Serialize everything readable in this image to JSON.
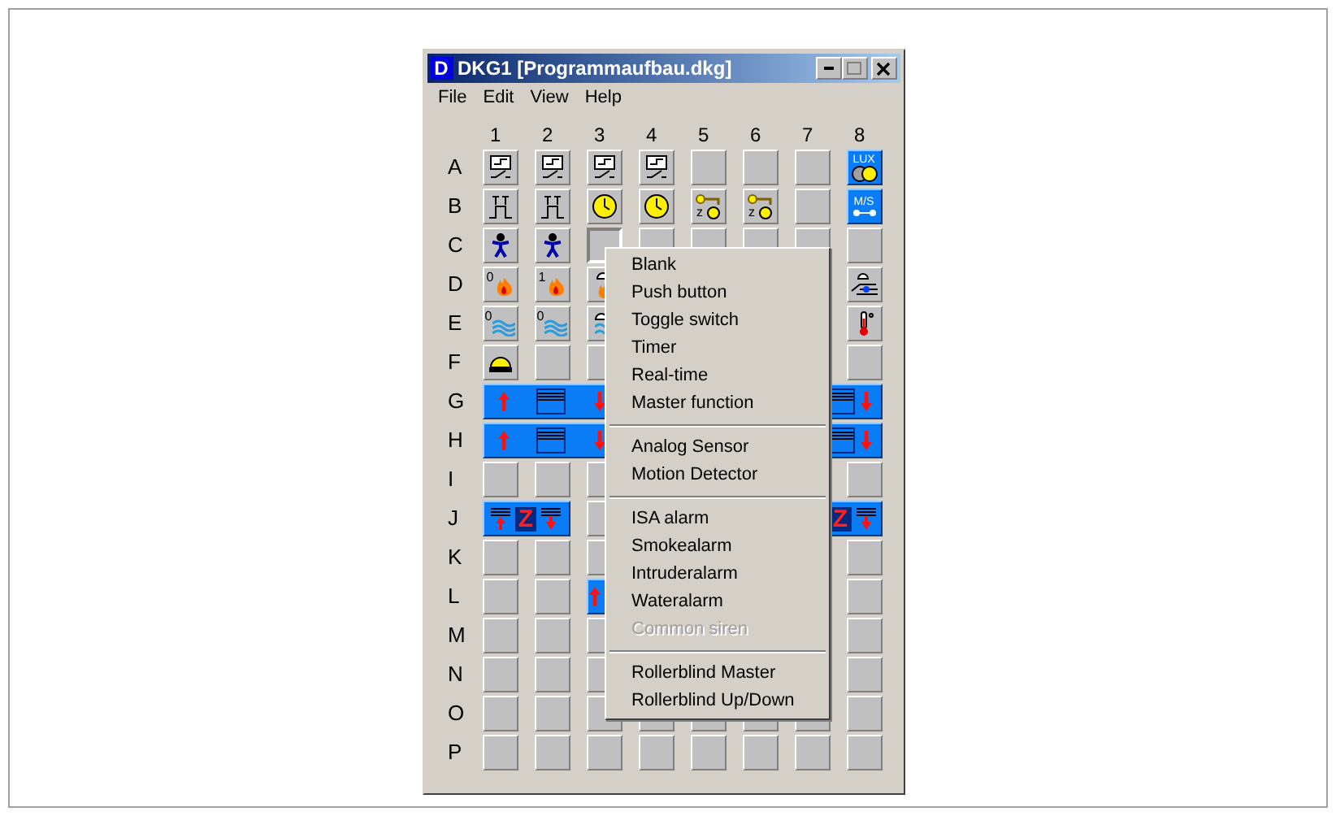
{
  "window": {
    "icon_letter": "D",
    "title": "DKG1 [Programmaufbau.dkg]"
  },
  "menu_bar": [
    {
      "label": "File"
    },
    {
      "label": "Edit"
    },
    {
      "label": "View"
    },
    {
      "label": "Help"
    }
  ],
  "columns": [
    "1",
    "2",
    "3",
    "4",
    "5",
    "6",
    "7",
    "8"
  ],
  "rows": [
    {
      "label": "A",
      "cells": [
        {
          "kind": "switch"
        },
        {
          "kind": "switch"
        },
        {
          "kind": "switch"
        },
        {
          "kind": "switch"
        },
        {
          "kind": "blank"
        },
        {
          "kind": "blank"
        },
        {
          "kind": "blank"
        },
        {
          "kind": "lux",
          "label": "LUX"
        }
      ]
    },
    {
      "label": "B",
      "cells": [
        {
          "kind": "pushbutton"
        },
        {
          "kind": "pushbutton"
        },
        {
          "kind": "clock"
        },
        {
          "kind": "clock"
        },
        {
          "kind": "realtime",
          "label": "z"
        },
        {
          "kind": "realtime",
          "label": "z"
        },
        {
          "kind": "blank"
        },
        {
          "kind": "ms",
          "label": "M/S"
        }
      ]
    },
    {
      "label": "C",
      "cells": [
        {
          "kind": "motion"
        },
        {
          "kind": "motion"
        },
        {
          "kind": "pressed"
        },
        {
          "kind": "blank"
        },
        {
          "kind": "blank"
        },
        {
          "kind": "blank"
        },
        {
          "kind": "blank"
        },
        {
          "kind": "blank"
        }
      ]
    },
    {
      "label": "D",
      "cells": [
        {
          "kind": "fire",
          "label": "0"
        },
        {
          "kind": "fire",
          "label": "1"
        },
        {
          "kind": "firedome"
        },
        {
          "kind": "covered"
        },
        {
          "kind": "hand"
        }
      ]
    },
    {
      "label": "E",
      "cells": [
        {
          "kind": "water",
          "label": "0"
        },
        {
          "kind": "water",
          "label": "0"
        },
        {
          "kind": "waterdome"
        },
        {
          "kind": "covered"
        },
        {
          "kind": "thermo"
        }
      ]
    },
    {
      "label": "F",
      "cells": [
        {
          "kind": "siren"
        },
        {
          "kind": "blank"
        },
        {
          "kind": "blank"
        },
        {
          "kind": "covered"
        },
        {
          "kind": "blank"
        }
      ]
    },
    {
      "label": "G",
      "cells": [
        {
          "kind": "blind"
        },
        {
          "kind": "covered"
        },
        {
          "kind": "blindend"
        }
      ]
    },
    {
      "label": "H",
      "cells": [
        {
          "kind": "blind"
        },
        {
          "kind": "covered"
        },
        {
          "kind": "blindend"
        }
      ]
    },
    {
      "label": "I",
      "cells": [
        {
          "kind": "blank"
        },
        {
          "kind": "blank"
        },
        {
          "kind": "blank"
        },
        {
          "kind": "covered"
        },
        {
          "kind": "blank"
        }
      ]
    },
    {
      "label": "J",
      "cells": [
        {
          "kind": "master",
          "label": "Z"
        },
        {
          "kind": "blank"
        },
        {
          "kind": "covered"
        },
        {
          "kind": "masterend",
          "label": "Z"
        }
      ]
    },
    {
      "label": "K",
      "cells": [
        {
          "kind": "blank"
        },
        {
          "kind": "blank"
        },
        {
          "kind": "blank"
        },
        {
          "kind": "covered"
        },
        {
          "kind": "blank"
        }
      ]
    },
    {
      "label": "L",
      "cells": [
        {
          "kind": "blank"
        },
        {
          "kind": "blank"
        },
        {
          "kind": "blindstub"
        },
        {
          "kind": "covered"
        },
        {
          "kind": "blank"
        }
      ]
    },
    {
      "label": "M",
      "cells": [
        {
          "kind": "blank"
        },
        {
          "kind": "blank"
        },
        {
          "kind": "blank"
        },
        {
          "kind": "covered"
        },
        {
          "kind": "blank"
        }
      ]
    },
    {
      "label": "N",
      "cells": [
        {
          "kind": "blank"
        },
        {
          "kind": "blank"
        },
        {
          "kind": "blank"
        },
        {
          "kind": "covered"
        },
        {
          "kind": "blank"
        }
      ]
    },
    {
      "label": "O",
      "cells": [
        {
          "kind": "blank"
        },
        {
          "kind": "blank"
        },
        {
          "kind": "blank"
        },
        {
          "kind": "blank"
        },
        {
          "kind": "blank"
        },
        {
          "kind": "blank"
        },
        {
          "kind": "blank"
        },
        {
          "kind": "blank"
        }
      ]
    },
    {
      "label": "P",
      "cells": [
        {
          "kind": "blank"
        },
        {
          "kind": "blank"
        },
        {
          "kind": "blank"
        },
        {
          "kind": "blank"
        },
        {
          "kind": "blank"
        },
        {
          "kind": "blank"
        },
        {
          "kind": "blank"
        },
        {
          "kind": "blank"
        }
      ]
    }
  ],
  "context_menu": [
    {
      "kind": "item",
      "label": "Blank",
      "disabled": false
    },
    {
      "kind": "item",
      "label": "Push button",
      "disabled": false
    },
    {
      "kind": "item",
      "label": "Toggle switch",
      "disabled": false
    },
    {
      "kind": "item",
      "label": "Timer",
      "disabled": false
    },
    {
      "kind": "item",
      "label": "Real-time",
      "disabled": false
    },
    {
      "kind": "item",
      "label": "Master function",
      "disabled": false
    },
    {
      "kind": "separator"
    },
    {
      "kind": "item",
      "label": "Analog Sensor",
      "disabled": false
    },
    {
      "kind": "item",
      "label": "Motion Detector",
      "disabled": false
    },
    {
      "kind": "separator"
    },
    {
      "kind": "item",
      "label": "ISA alarm",
      "disabled": false
    },
    {
      "kind": "item",
      "label": "Smokealarm",
      "disabled": false
    },
    {
      "kind": "item",
      "label": "Intruderalarm",
      "disabled": false
    },
    {
      "kind": "item",
      "label": "Wateralarm",
      "disabled": false
    },
    {
      "kind": "item",
      "label": "Common siren",
      "disabled": true
    },
    {
      "kind": "separator"
    },
    {
      "kind": "item",
      "label": "Rollerblind Master",
      "disabled": false
    },
    {
      "kind": "item",
      "label": "Rollerblind Up/Down",
      "disabled": false
    }
  ]
}
